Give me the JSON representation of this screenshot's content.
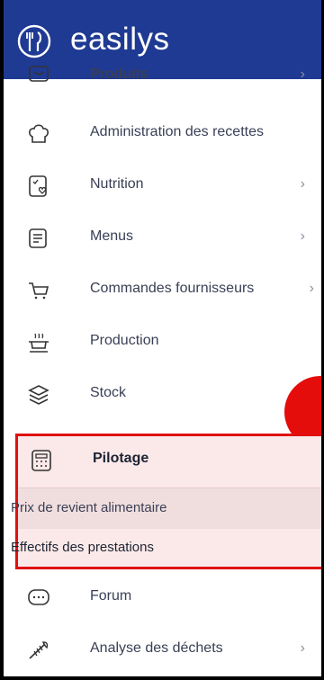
{
  "header": {
    "brand": "easilys",
    "logo_icon": "fork-knife-icon",
    "color": "#1f3a93"
  },
  "menu": {
    "items": [
      {
        "label": "Produits",
        "icon": "box-icon",
        "chevron": "›"
      },
      {
        "label": "Administration des recettes",
        "icon": "chef-hat-icon",
        "chevron": ""
      },
      {
        "label": "Nutrition",
        "icon": "checklist-heart-icon",
        "chevron": "›"
      },
      {
        "label": "Menus",
        "icon": "document-icon",
        "chevron": "›"
      },
      {
        "label": "Commandes fournisseurs",
        "icon": "cart-icon",
        "chevron": "›"
      },
      {
        "label": "Production",
        "icon": "cooking-pot-icon",
        "chevron": ""
      },
      {
        "label": "Stock",
        "icon": "layers-icon",
        "chevron": ""
      },
      {
        "label": "Pilotage",
        "icon": "calculator-icon",
        "chevron": ""
      },
      {
        "label": "Forum",
        "icon": "chat-bubble-icon",
        "chevron": ""
      },
      {
        "label": "Analyse des déchets",
        "icon": "fish-bone-icon",
        "chevron": "›"
      }
    ],
    "submenu": [
      "Prix de revient alimentaire",
      "Effectifs des prestations"
    ]
  },
  "highlight_color": "#e01010"
}
